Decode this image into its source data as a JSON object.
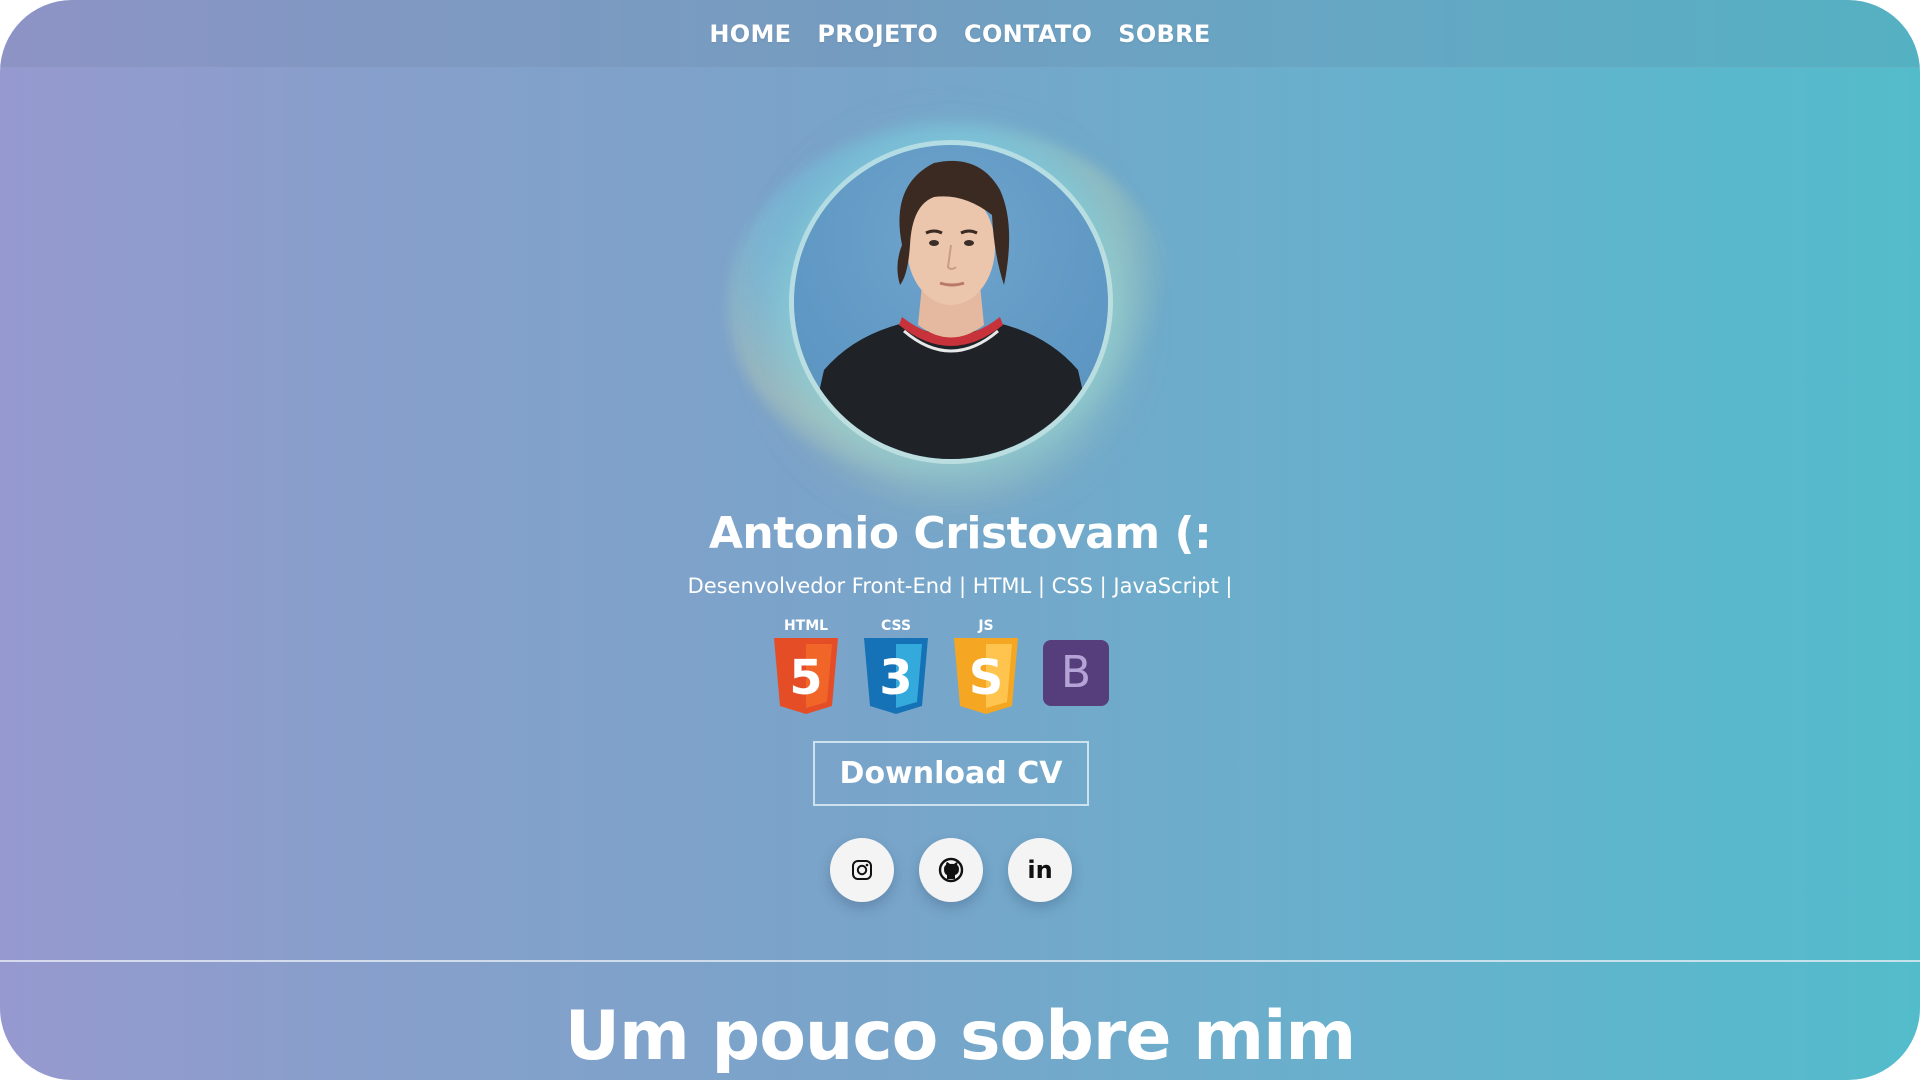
{
  "nav": {
    "items": [
      {
        "label": "HOME"
      },
      {
        "label": "PROJETO"
      },
      {
        "label": "CONTATO"
      },
      {
        "label": "SOBRE"
      }
    ]
  },
  "profile": {
    "name": "Antonio Cristovam (:",
    "subtitle": "Desenvolvedor Front-End | HTML | CSS | JavaScript |"
  },
  "tech_icons": [
    {
      "icon": "html5-icon",
      "label": "HTML",
      "glyph": "5",
      "color": "#e44d26"
    },
    {
      "icon": "css3-icon",
      "label": "CSS",
      "glyph": "3",
      "color": "#1572b6"
    },
    {
      "icon": "javascript-icon",
      "label": "JS",
      "glyph": "S",
      "color": "#f5a623"
    },
    {
      "icon": "bootstrap-icon",
      "glyph": "B",
      "color": "#563d7c"
    }
  ],
  "cta": {
    "download_label": "Download CV"
  },
  "social": [
    {
      "icon": "instagram-icon"
    },
    {
      "icon": "github-icon"
    },
    {
      "icon": "linkedin-icon",
      "glyph": "in"
    }
  ],
  "about": {
    "title": "Um pouco sobre mim"
  }
}
